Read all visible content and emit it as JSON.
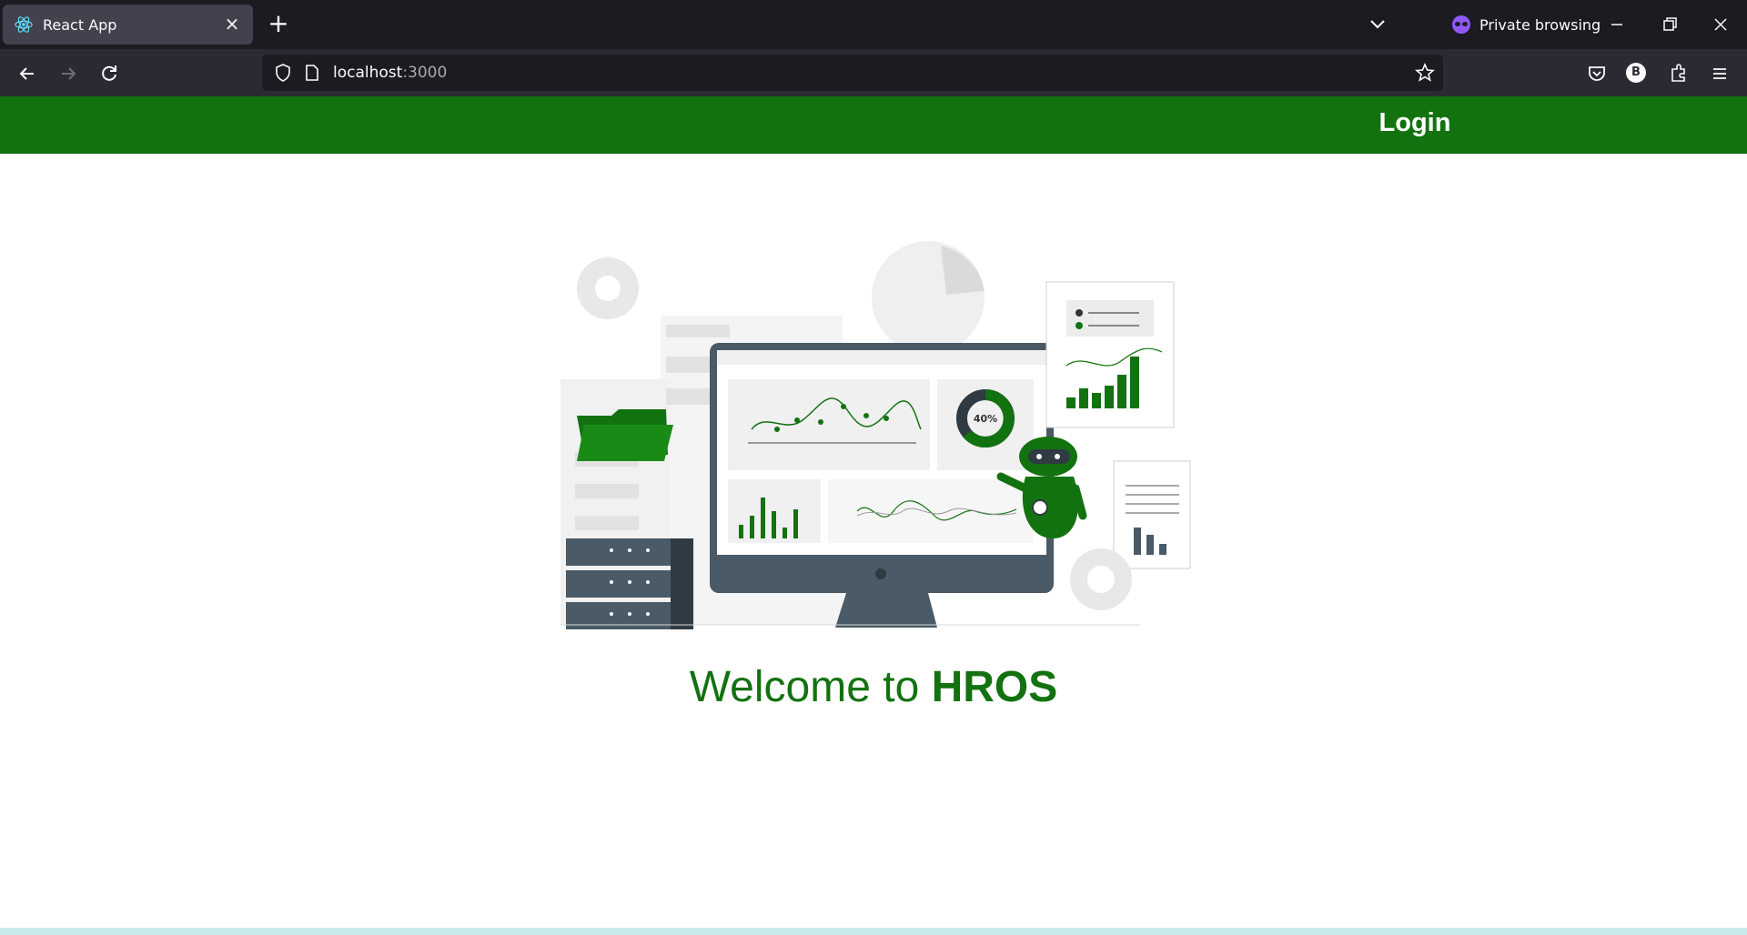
{
  "browser": {
    "tab_title": "React App",
    "url_host": "localhost",
    "url_port": ":3000",
    "private_label": "Private browsing",
    "profile_initial": "B"
  },
  "app": {
    "header": {
      "login_label": "Login",
      "color": "#137210"
    },
    "welcome_prefix": "Welcome to ",
    "welcome_brand": "HROS",
    "illustration": {
      "donut_label": "40%"
    }
  }
}
